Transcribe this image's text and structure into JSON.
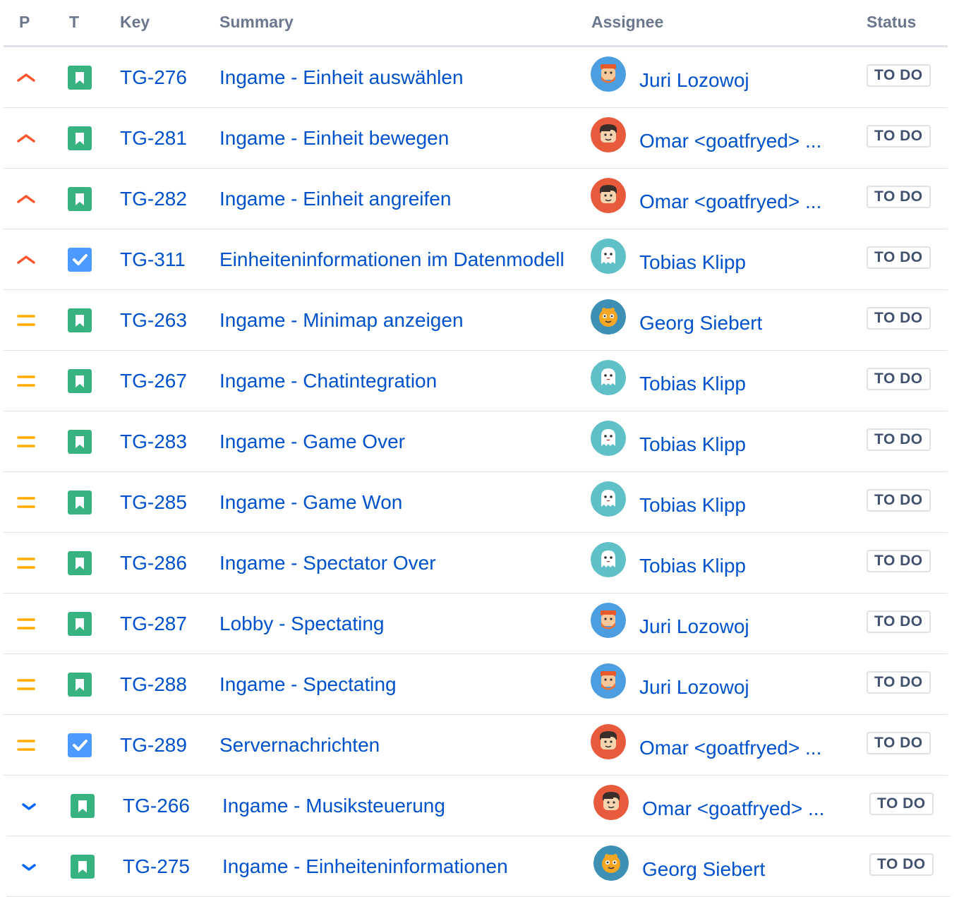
{
  "columns": {
    "p": "P",
    "t": "T",
    "key": "Key",
    "summary": "Summary",
    "assignee": "Assignee",
    "status": "Status"
  },
  "colors": {
    "link": "#0052cc",
    "priority_high": "#ff5630",
    "priority_medium": "#ffab00",
    "priority_low": "#0065ff",
    "story": "#36b37e",
    "task": "#4c9aff",
    "border": "#dfe1e6",
    "header_text": "#6b778c"
  },
  "rows": [
    {
      "priority": "high",
      "priority_icon": "priority-high-icon",
      "type": "story",
      "type_icon": "story-icon",
      "key": "TG-276",
      "summary": "Ingame - Einheit auswählen",
      "assignee": "Juri Lozowoj",
      "avatar": "juri",
      "status": "TO DO"
    },
    {
      "priority": "high",
      "priority_icon": "priority-high-icon",
      "type": "story",
      "type_icon": "story-icon",
      "key": "TG-281",
      "summary": "Ingame - Einheit bewegen",
      "assignee": "Omar <goatfryed> ...",
      "avatar": "omar",
      "status": "TO DO"
    },
    {
      "priority": "high",
      "priority_icon": "priority-high-icon",
      "type": "story",
      "type_icon": "story-icon",
      "key": "TG-282",
      "summary": "Ingame - Einheit angreifen",
      "assignee": "Omar <goatfryed> ...",
      "avatar": "omar",
      "status": "TO DO"
    },
    {
      "priority": "high",
      "priority_icon": "priority-high-icon",
      "type": "task",
      "type_icon": "task-icon",
      "key": "TG-311",
      "summary": "Einheiteninformationen im Datenmodell",
      "assignee": "Tobias Klipp",
      "avatar": "tobias",
      "status": "TO DO"
    },
    {
      "priority": "medium",
      "priority_icon": "priority-medium-icon",
      "type": "story",
      "type_icon": "story-icon",
      "key": "TG-263",
      "summary": "Ingame - Minimap anzeigen",
      "assignee": "Georg Siebert",
      "avatar": "georg",
      "status": "TO DO"
    },
    {
      "priority": "medium",
      "priority_icon": "priority-medium-icon",
      "type": "story",
      "type_icon": "story-icon",
      "key": "TG-267",
      "summary": "Ingame - Chatintegration",
      "assignee": "Tobias Klipp",
      "avatar": "tobias",
      "status": "TO DO"
    },
    {
      "priority": "medium",
      "priority_icon": "priority-medium-icon",
      "type": "story",
      "type_icon": "story-icon",
      "key": "TG-283",
      "summary": "Ingame - Game Over",
      "assignee": "Tobias Klipp",
      "avatar": "tobias",
      "status": "TO DO"
    },
    {
      "priority": "medium",
      "priority_icon": "priority-medium-icon",
      "type": "story",
      "type_icon": "story-icon",
      "key": "TG-285",
      "summary": "Ingame - Game Won",
      "assignee": "Tobias Klipp",
      "avatar": "tobias",
      "status": "TO DO"
    },
    {
      "priority": "medium",
      "priority_icon": "priority-medium-icon",
      "type": "story",
      "type_icon": "story-icon",
      "key": "TG-286",
      "summary": "Ingame - Spectator Over",
      "assignee": "Tobias Klipp",
      "avatar": "tobias",
      "status": "TO DO"
    },
    {
      "priority": "medium",
      "priority_icon": "priority-medium-icon",
      "type": "story",
      "type_icon": "story-icon",
      "key": "TG-287",
      "summary": "Lobby - Spectating",
      "assignee": "Juri Lozowoj",
      "avatar": "juri",
      "status": "TO DO"
    },
    {
      "priority": "medium",
      "priority_icon": "priority-medium-icon",
      "type": "story",
      "type_icon": "story-icon",
      "key": "TG-288",
      "summary": "Ingame - Spectating",
      "assignee": "Juri Lozowoj",
      "avatar": "juri",
      "status": "TO DO"
    },
    {
      "priority": "medium",
      "priority_icon": "priority-medium-icon",
      "type": "task",
      "type_icon": "task-icon",
      "key": "TG-289",
      "summary": "Servernachrichten",
      "assignee": "Omar <goatfryed> ...",
      "avatar": "omar",
      "status": "TO DO"
    },
    {
      "priority": "low",
      "priority_icon": "priority-low-icon",
      "type": "story",
      "type_icon": "story-icon",
      "key": "TG-266",
      "summary": "Ingame - Musiksteuerung",
      "assignee": "Omar <goatfryed> ...",
      "avatar": "omar",
      "status": "TO DO"
    },
    {
      "priority": "low",
      "priority_icon": "priority-low-icon",
      "type": "story",
      "type_icon": "story-icon",
      "key": "TG-275",
      "summary": "Ingame - Einheiteninformationen",
      "assignee": "Georg Siebert",
      "avatar": "georg",
      "status": "TO DO"
    }
  ]
}
